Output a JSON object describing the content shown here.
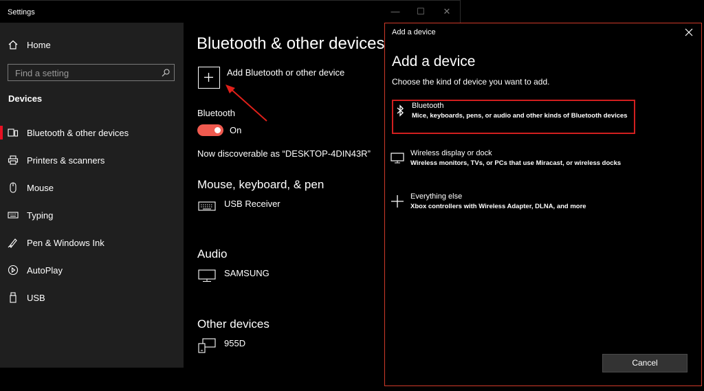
{
  "settings": {
    "window_title": "Settings",
    "window_controls": {
      "minimize": "—",
      "maximize": "☐",
      "close": "✕"
    },
    "sidebar": {
      "home_label": "Home",
      "search_placeholder": "Find a setting",
      "section_heading": "Devices",
      "items": [
        {
          "label": "Bluetooth & other devices",
          "icon": "bluetooth-devices-icon",
          "active": true
        },
        {
          "label": "Printers & scanners",
          "icon": "printer-icon",
          "active": false
        },
        {
          "label": "Mouse",
          "icon": "mouse-icon",
          "active": false
        },
        {
          "label": "Typing",
          "icon": "keyboard-icon",
          "active": false
        },
        {
          "label": "Pen & Windows Ink",
          "icon": "pen-icon",
          "active": false
        },
        {
          "label": "AutoPlay",
          "icon": "autoplay-icon",
          "active": false
        },
        {
          "label": "USB",
          "icon": "usb-icon",
          "active": false
        }
      ]
    },
    "main": {
      "title": "Bluetooth & other devices",
      "add_device_label": "Add Bluetooth or other device",
      "bluetooth_label": "Bluetooth",
      "bluetooth_state": "On",
      "discoverable_text": "Now discoverable as “DESKTOP-4DIN43R”",
      "sections": [
        {
          "heading": "Mouse, keyboard, & pen",
          "devices": [
            {
              "name": "USB Receiver",
              "icon": "keyboard-icon"
            }
          ]
        },
        {
          "heading": "Audio",
          "devices": [
            {
              "name": "SAMSUNG",
              "icon": "monitor-icon"
            }
          ]
        },
        {
          "heading": "Other devices",
          "devices": [
            {
              "name": "955D",
              "icon": "device-icon"
            }
          ]
        }
      ]
    }
  },
  "dialog": {
    "window_title": "Add a device",
    "heading": "Add a device",
    "subtitle": "Choose the kind of device you want to add.",
    "options": [
      {
        "title": "Bluetooth",
        "description": "Mice, keyboards, pens, or audio and other kinds of Bluetooth devices",
        "icon": "bluetooth-icon",
        "highlighted": true
      },
      {
        "title": "Wireless display or dock",
        "description": "Wireless monitors, TVs, or PCs that use Miracast, or wireless docks",
        "icon": "monitor-icon",
        "highlighted": false
      },
      {
        "title": "Everything else",
        "description": "Xbox controllers with Wireless Adapter, DLNA, and more",
        "icon": "plus-icon",
        "highlighted": false
      }
    ],
    "cancel_label": "Cancel"
  },
  "colors": {
    "accent_red": "#e81123",
    "toggle_on": "#f05a4f",
    "highlight_border": "#d21f1f",
    "dialog_border": "#d23a2a",
    "annotation_arrow": "#e0201a",
    "sidebar_bg": "#1f1f1f",
    "page_bg": "#000000"
  }
}
